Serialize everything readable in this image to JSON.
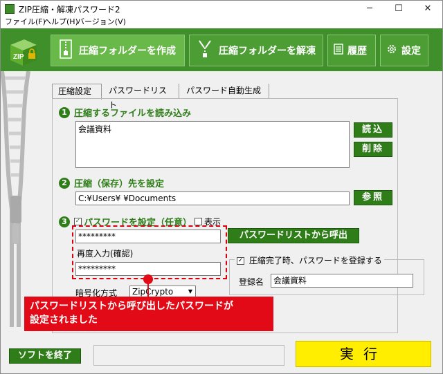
{
  "window": {
    "title": "ZIP圧縮・解凍パスワード2",
    "minimize": "─",
    "maximize": "☐",
    "close": "✕"
  },
  "menu": [
    "ファイル(F)",
    "ヘルプ(H)",
    "バージョン(V)"
  ],
  "toolbar": {
    "logo_text": "ZIP",
    "compress_label": "圧縮フォルダーを作成",
    "extract_label": "圧縮フォルダーを解凍",
    "history_label": "履歴",
    "settings_label": "設定"
  },
  "tabs": [
    "圧縮設定",
    "パスワードリスト",
    "パスワード自動生成"
  ],
  "section1": {
    "number": "1",
    "title": "圧縮するファイルを読み込み",
    "files": [
      "会議資料"
    ],
    "load_label": "読込",
    "delete_label": "削除"
  },
  "section2": {
    "number": "2",
    "title": "圧縮（保存）先を設定",
    "path": "C:¥Users¥      ¥Documents",
    "browse_label": "参照"
  },
  "section3": {
    "number": "3",
    "title": "パスワードを設定（任意）",
    "show_label": "表示",
    "password": "*********",
    "confirm_label": "再度入力(確認)",
    "password_confirm": "*********",
    "from_list_label": "パスワードリストから呼出",
    "register_check_label": "圧縮完了時、パスワードを登録する",
    "register_name_label": "登録名",
    "register_name_value": "会議資料",
    "encryption_label": "暗号化方式",
    "encryption_value": "ZipCrypto"
  },
  "callout": {
    "line1": "パスワードリストから呼び出したパスワードが",
    "line2": "設定されました"
  },
  "footer": {
    "quit_label": "ソフトを終了",
    "execute_label": "実行"
  },
  "colors": {
    "toolbar_green": "#3f8f2b",
    "accent_green": "#2f7d19",
    "callout_red": "#e30a17",
    "execute_yellow": "#ffee00"
  }
}
